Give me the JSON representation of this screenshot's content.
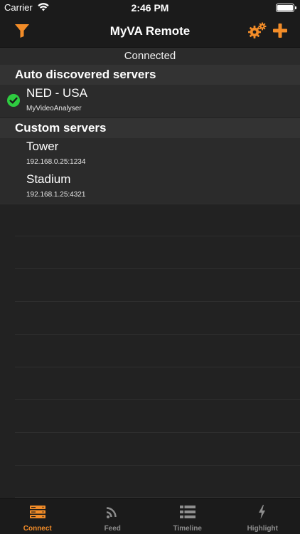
{
  "status_bar": {
    "carrier": "Carrier",
    "time": "2:46 PM"
  },
  "nav": {
    "title": "MyVA Remote",
    "icons": {
      "left": "filter-icon",
      "right": [
        "settings-gear-icon",
        "plus-icon"
      ]
    }
  },
  "connection": {
    "status": "Connected"
  },
  "sections": {
    "auto": {
      "title": "Auto discovered servers",
      "servers": [
        {
          "name": "NED - USA",
          "detail": "MyVideoAnalyser",
          "status_icon": "check-circle-icon"
        }
      ]
    },
    "custom": {
      "title": "Custom servers",
      "servers": [
        {
          "name": "Tower",
          "detail": "192.168.0.25:1234"
        },
        {
          "name": "Stadium",
          "detail": "192.168.1.25:4321"
        }
      ]
    }
  },
  "tabs": [
    {
      "label": "Connect",
      "icon": "server-stack-icon",
      "active": true
    },
    {
      "label": "Feed",
      "icon": "rss-icon",
      "active": false
    },
    {
      "label": "Timeline",
      "icon": "list-icon",
      "active": false
    },
    {
      "label": "Highlight",
      "icon": "bolt-icon",
      "active": false
    }
  ],
  "colors": {
    "accent": "#f28c28",
    "success": "#2ecc40",
    "background": "#222222",
    "bar": "#1b1b1b",
    "row": "#2b2b2b",
    "section_header": "#333333",
    "tab_inactive": "#8e8e8e"
  }
}
